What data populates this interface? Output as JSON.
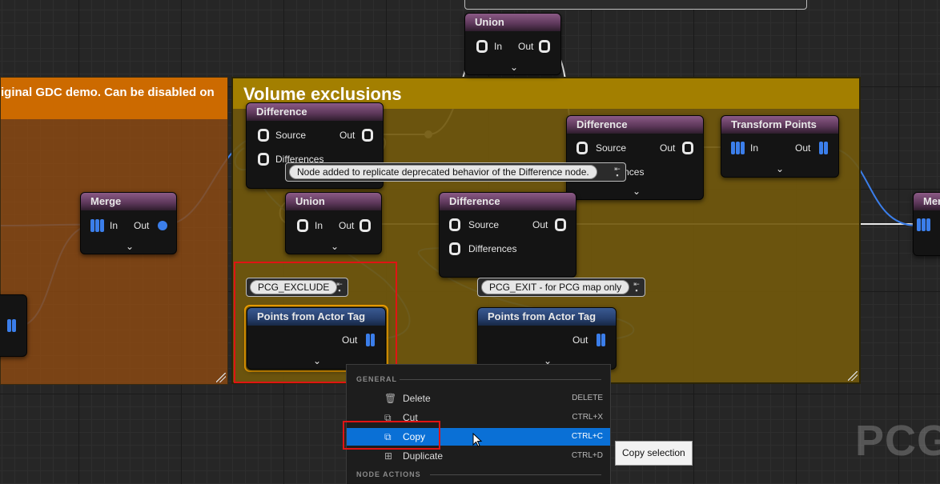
{
  "comments": {
    "orange_title": "iginal GDC demo. Can be disabled on",
    "yellow_title": "Volume exclusions"
  },
  "nodes": {
    "union_top": {
      "title": "Union",
      "in": "In",
      "out": "Out"
    },
    "difference_1": {
      "title": "Difference",
      "source": "Source",
      "out": "Out",
      "differences": "Differences"
    },
    "difference_2": {
      "title": "Difference",
      "source": "Source",
      "out": "Out",
      "differences": "Differences"
    },
    "transform_points": {
      "title": "Transform Points",
      "in": "In",
      "out": "Out"
    },
    "merge_left": {
      "title": "Merge",
      "in": "In",
      "out": "Out"
    },
    "union_mid": {
      "title": "Union",
      "in": "In",
      "out": "Out"
    },
    "difference_3": {
      "title": "Difference",
      "source": "Source",
      "out": "Out",
      "differences": "Differences"
    },
    "points_actor_tag_1": {
      "title": "Points from Actor Tag",
      "out": "Out"
    },
    "points_actor_tag_2": {
      "title": "Points from Actor Tag",
      "out": "Out"
    },
    "merge_right": {
      "title": "Mer"
    }
  },
  "tooltip_note": "Node added to replicate deprecated behavior of the Difference node.",
  "tags": {
    "exclude": "PCG_EXCLUDE",
    "exit": "PCG_EXIT - for PCG map only"
  },
  "context_menu": {
    "section_general": "GENERAL",
    "section_node_actions": "NODE ACTIONS",
    "items": [
      {
        "label": "Delete",
        "shortcut": "DELETE",
        "icon": "trash-icon"
      },
      {
        "label": "Cut",
        "shortcut": "CTRL+X",
        "icon": "cut-icon"
      },
      {
        "label": "Copy",
        "shortcut": "CTRL+C",
        "icon": "copy-icon"
      },
      {
        "label": "Duplicate",
        "shortcut": "CTRL+D",
        "icon": "duplicate-icon"
      }
    ]
  },
  "copy_tooltip": "Copy selection",
  "watermark": "PCG",
  "colors": {
    "accent_blue": "#0a70d6",
    "highlight_red": "#e01414",
    "selection_orange": "#f0a000",
    "pin_blue": "#3b7eea"
  }
}
